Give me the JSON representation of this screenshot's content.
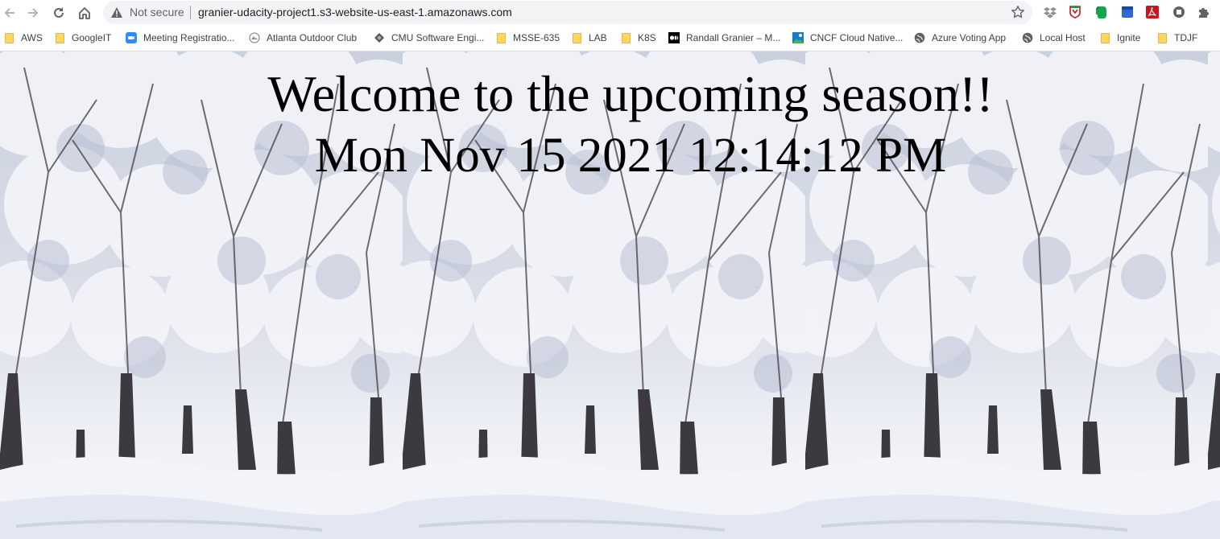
{
  "browser": {
    "security_label": "Not secure",
    "url": "granier-udacity-project1.s3-website-us-east-1.amazonaws.com",
    "icons": [
      "back-icon",
      "forward-icon",
      "reload-icon",
      "home-icon",
      "warning-icon",
      "star-icon",
      "dropbox-icon",
      "mcafee-icon",
      "evernote-icon",
      "calendar-icon",
      "adobe-pdf-icon",
      "tab-extension-icon",
      "puzzle-icon"
    ]
  },
  "bookmarks": [
    {
      "label": "AWS",
      "icon": "folder-icon"
    },
    {
      "label": "GoogleIT",
      "icon": "folder-icon"
    },
    {
      "label": "Meeting Registratio...",
      "icon": "zoom-icon"
    },
    {
      "label": "Atlanta Outdoor Club",
      "icon": "club-logo-icon"
    },
    {
      "label": "CMU Software Engi...",
      "icon": "cmu-icon"
    },
    {
      "label": "MSSE-635",
      "icon": "folder-icon"
    },
    {
      "label": "LAB",
      "icon": "folder-icon"
    },
    {
      "label": "K8S",
      "icon": "folder-icon"
    },
    {
      "label": "Randall Granier – M...",
      "icon": "medium-icon"
    },
    {
      "label": "CNCF Cloud Native...",
      "icon": "cncf-icon"
    },
    {
      "label": "Azure Voting App",
      "icon": "globe-icon"
    },
    {
      "label": "Local Host",
      "icon": "globe-icon"
    },
    {
      "label": "Ignite",
      "icon": "folder-icon"
    },
    {
      "label": "TDJF",
      "icon": "folder-icon"
    }
  ],
  "page": {
    "heading": "Welcome to the upcoming season!!",
    "datetime": "Mon Nov 15 2021 12:14:12 PM",
    "background": "snowy-forest-photo (tiled)"
  },
  "colors": {
    "chrome_bg": "#ffffff",
    "omnibox_bg": "#f1f3f4",
    "folder_yellow": "#fdd663",
    "text_black": "#000000"
  }
}
